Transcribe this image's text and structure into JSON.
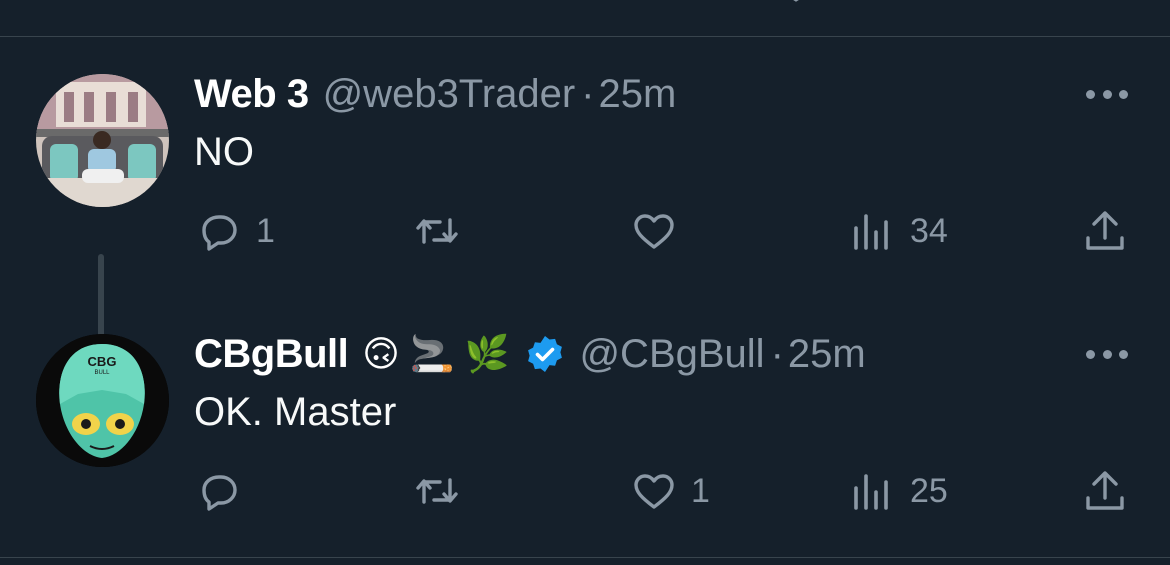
{
  "tweets": [
    {
      "name": "Web 3",
      "handle": "@web3Trader",
      "separator": "·",
      "time": "25m",
      "text": "NO",
      "counts": {
        "replies": "1",
        "retweets": "",
        "likes": "",
        "views": "34"
      }
    },
    {
      "name": "CBgBull",
      "emojis": [
        "🙃",
        "🚬",
        "🌿"
      ],
      "handle": "@CBgBull",
      "separator": "·",
      "time": "25m",
      "text": "OK. Master",
      "verified": true,
      "avatar_text": {
        "line1": "CBG",
        "line2": "BULL"
      },
      "counts": {
        "replies": "",
        "retweets": "",
        "likes": "1",
        "views": "25"
      }
    }
  ],
  "colors": {
    "background": "#15202b",
    "secondary_text": "#8b98a5",
    "divider": "#38444d",
    "verified": "#1d9bf0"
  }
}
